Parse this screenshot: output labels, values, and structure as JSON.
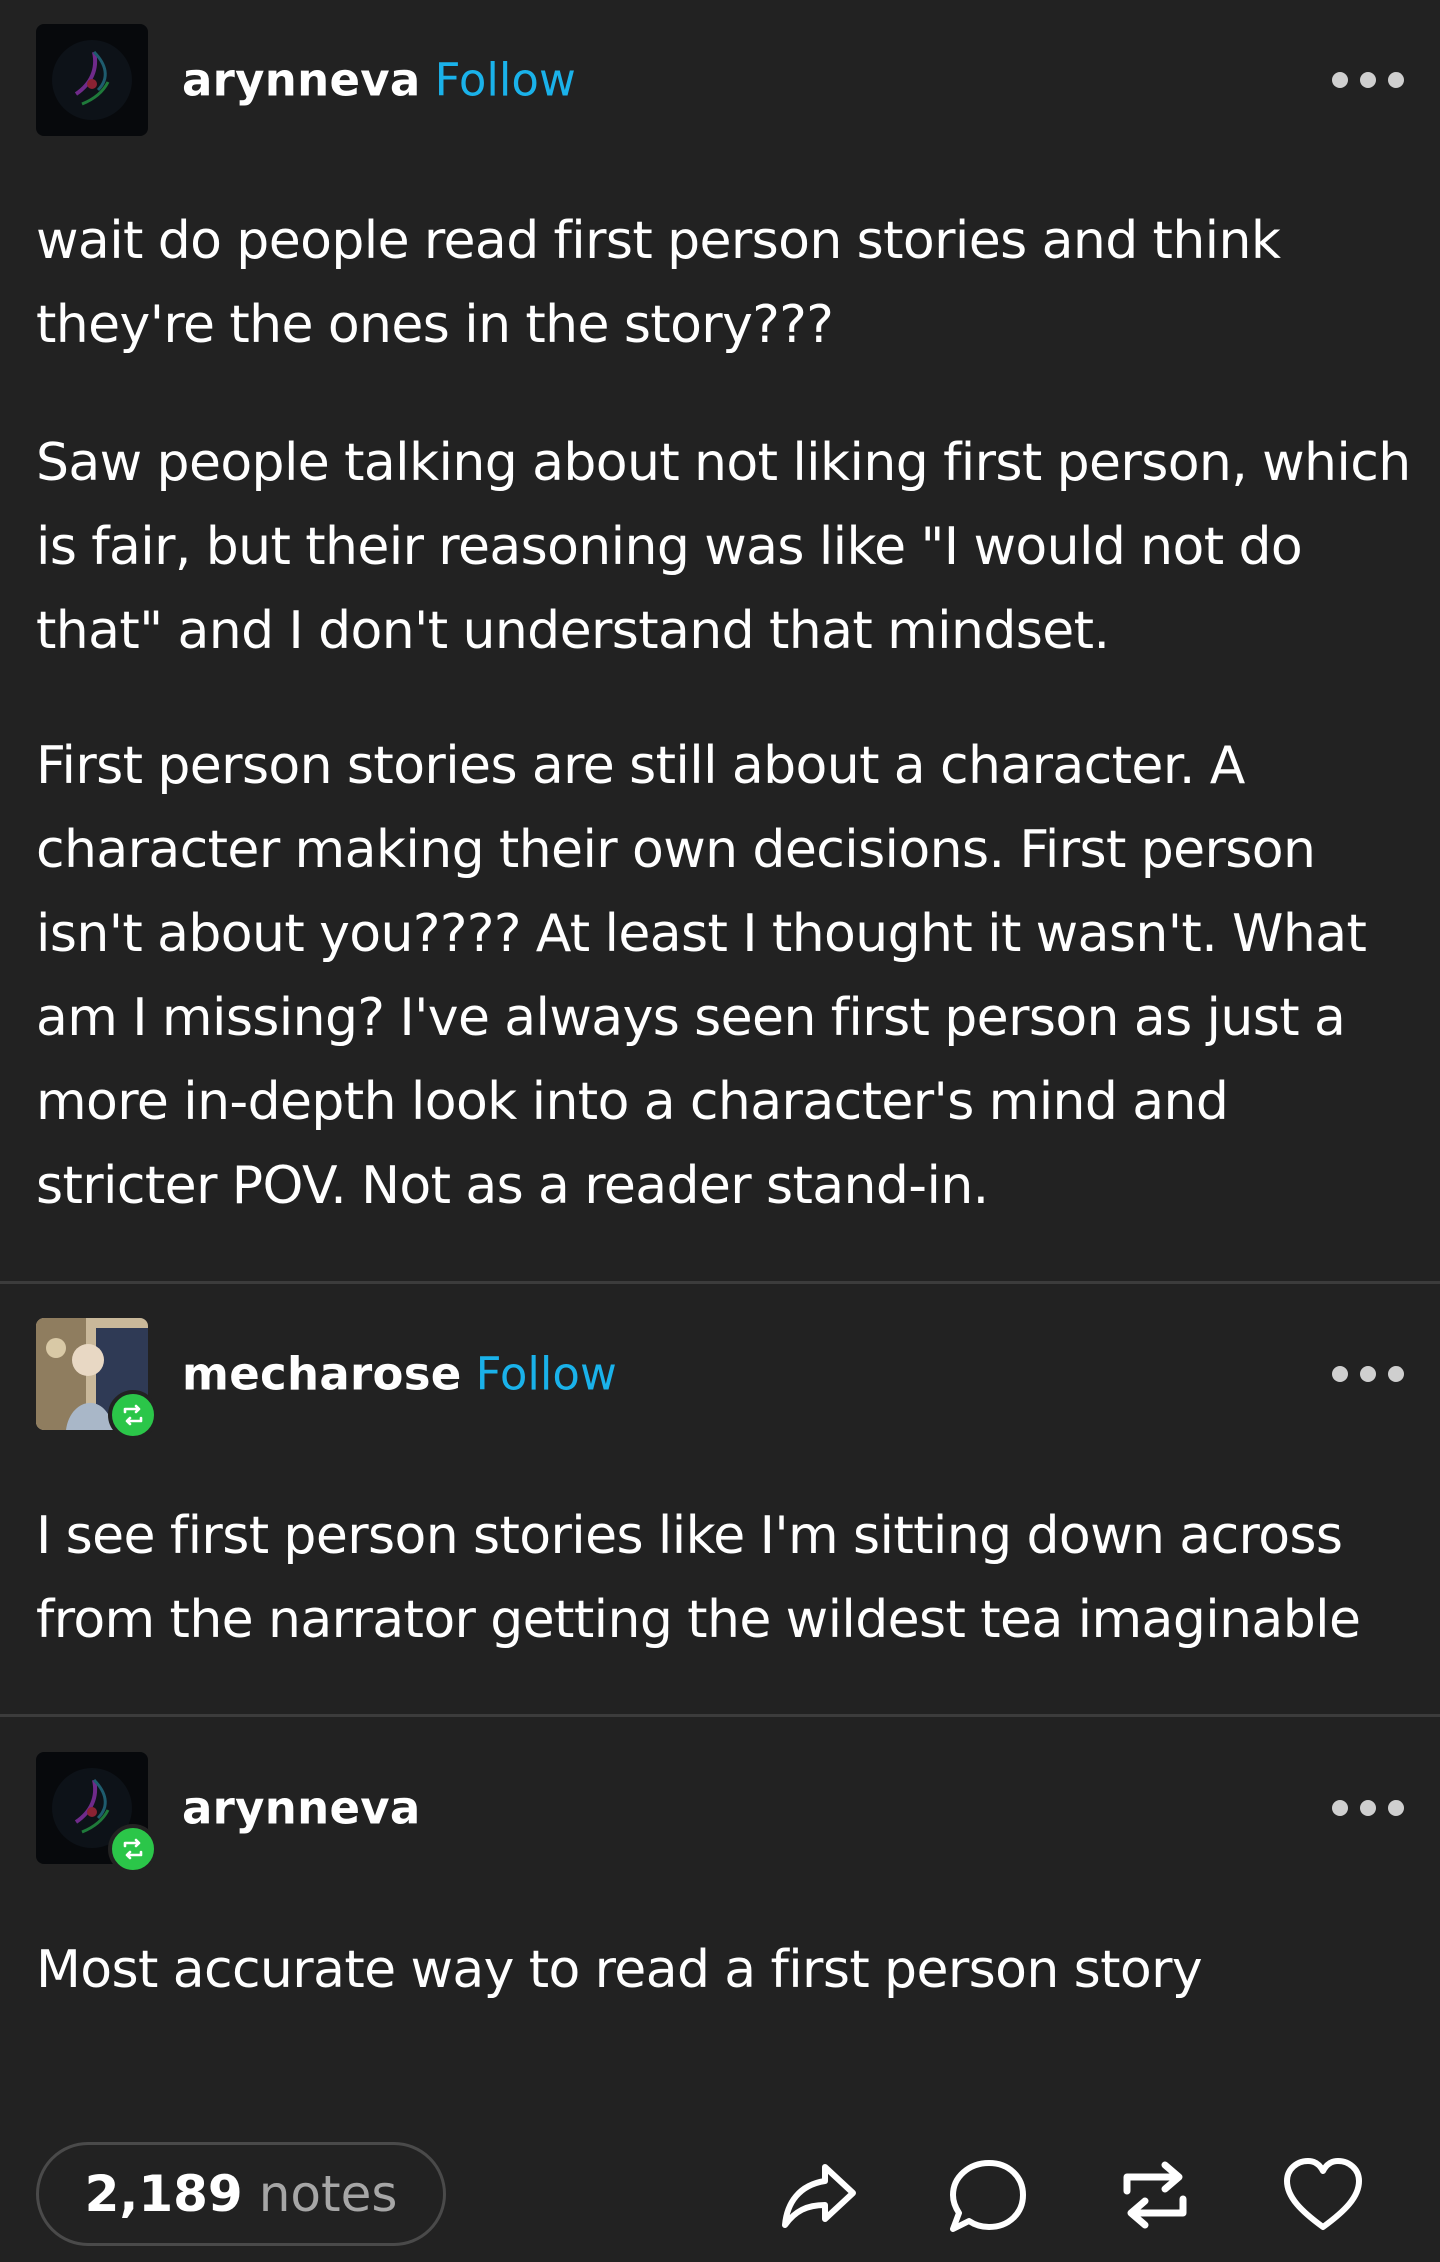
{
  "posts": [
    {
      "username": "arynneva",
      "follow_label": "Follow",
      "paragraphs": [
        "wait do people read first person stories and think they're the ones in the story???",
        "Saw people talking about not liking first person, which is fair, but their reasoning was like \"I would not do that\" and I don't understand that mindset.",
        "First person stories are still about a character. A character making their own decisions. First person isn't about you???? At least I thought it wasn't. What am I missing? I've always seen first person as just a more in-depth look into a character's mind and stricter POV. Not as a reader stand-in."
      ]
    },
    {
      "username": "mecharose",
      "follow_label": "Follow",
      "paragraphs": [
        "I see first person stories like I'm sitting down across from the narrator getting the wildest tea imaginable"
      ]
    },
    {
      "username": "arynneva",
      "paragraphs": [
        "Most accurate way to read a first person story"
      ]
    }
  ],
  "footer": {
    "notes_count": "2,189",
    "notes_label": "notes"
  },
  "colors": {
    "background": "#222222",
    "follow": "#1ab2ea",
    "reblog_badge": "#2bc649",
    "divider": "#3c3c3c",
    "muted_text": "#a6a6a6"
  },
  "icons": [
    "more-options-icon",
    "reblog-icon",
    "share-icon",
    "reply-icon",
    "reblog-action-icon",
    "like-icon"
  ]
}
